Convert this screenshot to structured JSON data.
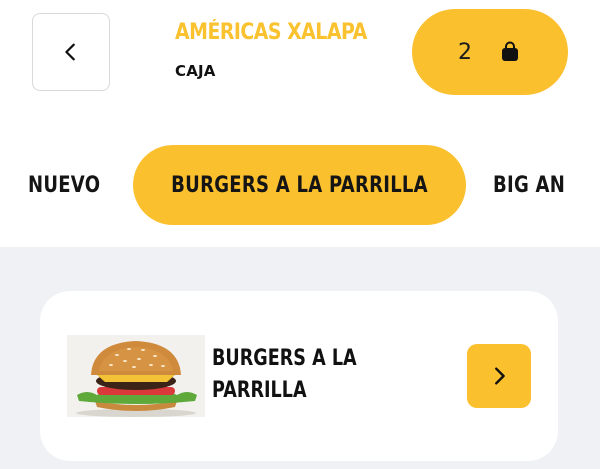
{
  "header": {
    "store_name": "AMÉRICAS XALAPA",
    "store_subtitle": "CAJA",
    "cart_count": "2",
    "back_icon": "chevron-left-icon",
    "cart_icon": "shopping-bag-icon"
  },
  "categories": {
    "tabs": [
      {
        "label": "NUEVO",
        "active": false
      },
      {
        "label": "BURGERS A LA PARRILLA",
        "active": true
      },
      {
        "label": "BIG AN",
        "active": false
      }
    ]
  },
  "products": {
    "items": [
      {
        "title_line1": "BURGERS A LA",
        "title_line2": "PARRILLA",
        "image": "grilled-burger-photo",
        "action_icon": "chevron-right-icon"
      }
    ]
  },
  "colors": {
    "brand_yellow": "#fbc02d",
    "store_name_yellow": "#f9c22e",
    "background_gray": "#eff1f5"
  }
}
